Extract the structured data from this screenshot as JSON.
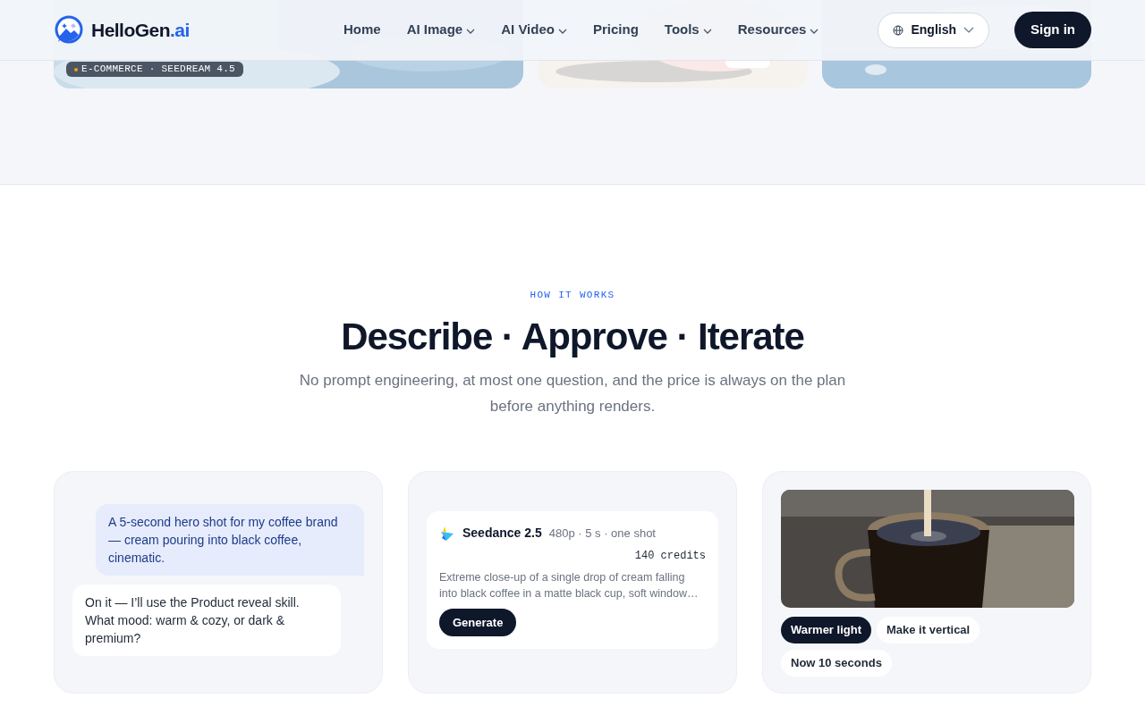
{
  "header": {
    "brand": {
      "name": "HelloGen",
      "suffix": ".ai"
    },
    "nav": [
      {
        "label": "Home",
        "dropdown": false
      },
      {
        "label": "AI Image",
        "dropdown": true
      },
      {
        "label": "AI Video",
        "dropdown": true
      },
      {
        "label": "Pricing",
        "dropdown": false
      },
      {
        "label": "Tools",
        "dropdown": true
      },
      {
        "label": "Resources",
        "dropdown": true
      }
    ],
    "language": "English",
    "sign_in": "Sign in"
  },
  "gallery": [
    {
      "kind": "picture",
      "tag": "E-COMMERCE · SEEDREAM 4.5"
    },
    {
      "kind": "picture"
    },
    {
      "kind": "picture"
    }
  ],
  "how_it_works": {
    "eyebrow": "HOW IT WORKS",
    "title": "Describe · Approve · Iterate",
    "subtitle": "No prompt engineering, at most one question, and the price is always on the plan before anything renders.",
    "steps": [
      {
        "kind": "chat",
        "messages": [
          {
            "kind": "user",
            "text": "A 5-second hero shot for my coffee brand — cream pouring into black coffee, cinematic."
          },
          {
            "kind": "assistant",
            "text": "On it — I’ll use the Product reveal skill. What mood: warm & cozy, or dark & premium?"
          }
        ]
      },
      {
        "kind": "plan",
        "model": "Seedance 2.5",
        "specs": "480p · 5 s · one shot",
        "cost": "140 credits",
        "prompt": "Extreme close-up of a single drop of cream falling into black coffee in a matte black cup, soft window…",
        "button": "Generate"
      },
      {
        "kind": "result",
        "picture": {
          "kind": "picture"
        },
        "chips": [
          {
            "label": "Warmer light",
            "selected": true
          },
          {
            "label": "Make it vertical",
            "selected": false
          },
          {
            "label": "Now 10 seconds",
            "selected": false
          }
        ]
      }
    ]
  }
}
